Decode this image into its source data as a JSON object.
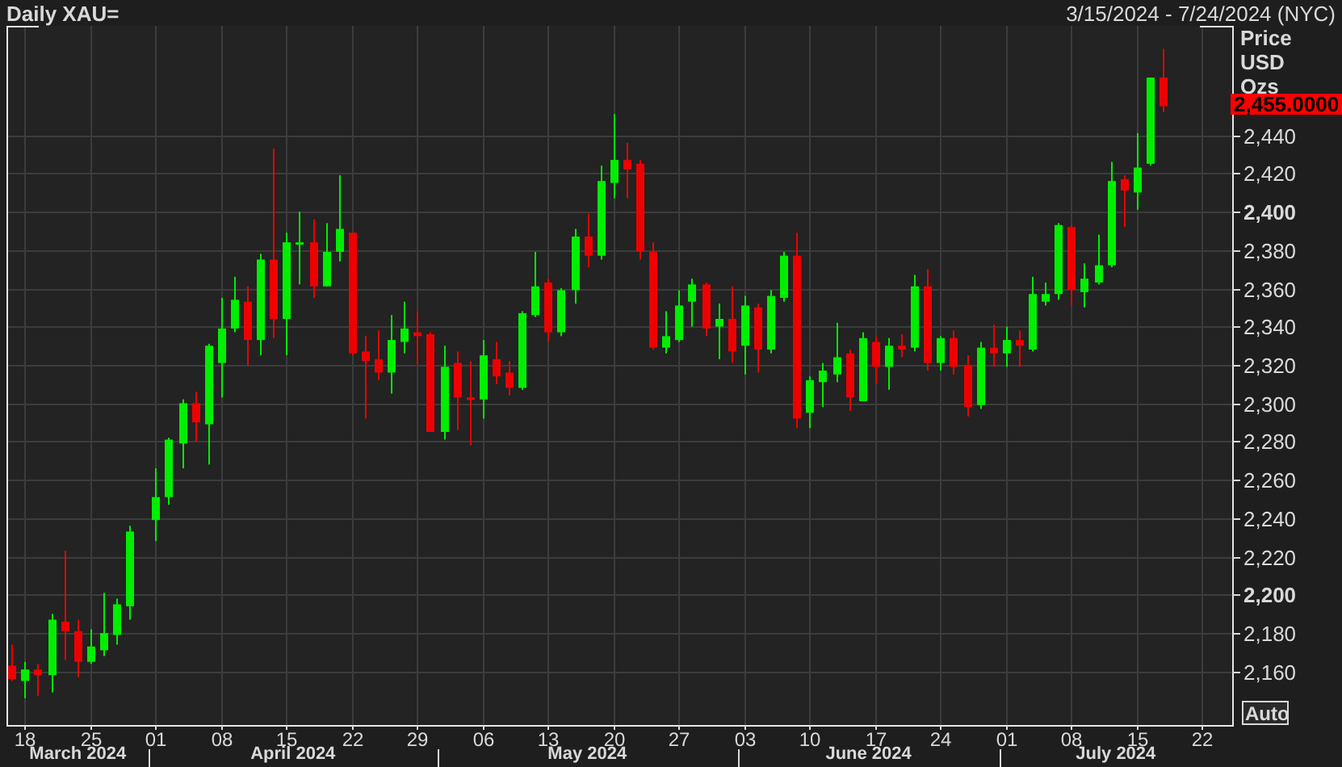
{
  "header": {
    "title": "Daily XAU=",
    "date_range": "3/15/2024 - 7/24/2024 (NYC)"
  },
  "chart": {
    "axis_titles": [
      "Price",
      "USD",
      "Ozs"
    ],
    "last_price": "2,455.0000",
    "auto_button": "Auto",
    "chart_data": {
      "type": "candlestick",
      "grid": true,
      "categories": [
        null,
        "18",
        null,
        null,
        null,
        null,
        "25",
        null,
        null,
        null,
        null,
        "01",
        null,
        null,
        null,
        null,
        "08",
        null,
        null,
        null,
        null,
        "15",
        null,
        null,
        null,
        null,
        "22",
        null,
        null,
        null,
        null,
        "29",
        null,
        null,
        null,
        null,
        "06",
        null,
        null,
        null,
        null,
        "13",
        null,
        null,
        null,
        null,
        "20",
        null,
        null,
        null,
        null,
        "27",
        null,
        null,
        null,
        null,
        "03",
        null,
        null,
        null,
        null,
        "10",
        null,
        null,
        null,
        null,
        "17",
        null,
        null,
        null,
        null,
        "24",
        null,
        null,
        null,
        null,
        "01",
        null,
        null,
        null,
        null,
        "08",
        null,
        null,
        null,
        null,
        "15",
        null,
        null,
        null,
        null,
        "22"
      ],
      "ohlc": [
        [
          2163,
          2174,
          2155,
          2156
        ],
        [
          2155,
          2165,
          2146,
          2161
        ],
        [
          2161,
          2164,
          2147,
          2158
        ],
        [
          2158,
          2190,
          2149,
          2187
        ],
        [
          2186,
          2223,
          2166,
          2181
        ],
        [
          2181,
          2187,
          2157,
          2165
        ],
        [
          2165,
          2182,
          2164,
          2173
        ],
        [
          2171,
          2201,
          2168,
          2180
        ],
        [
          2179,
          2198,
          2174,
          2195
        ],
        [
          2194,
          2236,
          2187,
          2233
        ],
        null,
        [
          2239,
          2266,
          2228,
          2251
        ],
        [
          2251,
          2282,
          2247,
          2281
        ],
        [
          2279,
          2302,
          2266,
          2300
        ],
        [
          2300,
          2306,
          2280,
          2290
        ],
        [
          2289,
          2331,
          2268,
          2330
        ],
        [
          2321,
          2355,
          2303,
          2339
        ],
        [
          2339,
          2366,
          2337,
          2354
        ],
        [
          2353,
          2361,
          2320,
          2333
        ],
        [
          2333,
          2378,
          2325,
          2375
        ],
        [
          2375,
          2433,
          2334,
          2344
        ],
        [
          2344,
          2389,
          2325,
          2384
        ],
        [
          2383,
          2400,
          2362,
          2384
        ],
        [
          2384,
          2396,
          2355,
          2361
        ],
        [
          2361,
          2394,
          2361,
          2379
        ],
        [
          2379,
          2419,
          2374,
          2391
        ],
        [
          2389,
          2389,
          2325,
          2326
        ],
        [
          2327,
          2335,
          2292,
          2322
        ],
        [
          2323,
          2338,
          2312,
          2316
        ],
        [
          2316,
          2346,
          2305,
          2333
        ],
        [
          2332,
          2353,
          2326,
          2339
        ],
        [
          2337,
          2348,
          2320,
          2335
        ],
        [
          2336,
          2337,
          2285,
          2285
        ],
        [
          2285,
          2330,
          2281,
          2319
        ],
        [
          2321,
          2327,
          2286,
          2303
        ],
        [
          2303,
          2322,
          2278,
          2302
        ],
        [
          2302,
          2333,
          2292,
          2325
        ],
        [
          2323,
          2332,
          2310,
          2314
        ],
        [
          2316,
          2322,
          2304,
          2308
        ],
        [
          2308,
          2348,
          2307,
          2347
        ],
        [
          2346,
          2379,
          2345,
          2361
        ],
        [
          2363,
          2365,
          2332,
          2337
        ],
        [
          2337,
          2360,
          2335,
          2359
        ],
        [
          2359,
          2391,
          2352,
          2387
        ],
        [
          2387,
          2399,
          2371,
          2377
        ],
        [
          2377,
          2424,
          2375,
          2416
        ],
        [
          2415,
          2451,
          2407,
          2427
        ],
        [
          2427,
          2436,
          2407,
          2422
        ],
        [
          2425,
          2427,
          2375,
          2379
        ],
        [
          2379,
          2384,
          2328,
          2329
        ],
        [
          2329,
          2348,
          2326,
          2335
        ],
        [
          2333,
          2359,
          2332,
          2351
        ],
        [
          2353,
          2365,
          2340,
          2362
        ],
        [
          2362,
          2363,
          2335,
          2339
        ],
        [
          2340,
          2352,
          2323,
          2344
        ],
        [
          2344,
          2361,
          2321,
          2327
        ],
        [
          2330,
          2356,
          2315,
          2351
        ],
        [
          2350,
          2352,
          2316,
          2328
        ],
        [
          2328,
          2359,
          2326,
          2356
        ],
        [
          2355,
          2379,
          2353,
          2377
        ],
        [
          2377,
          2389,
          2287,
          2292
        ],
        [
          2295,
          2314,
          2287,
          2312
        ],
        [
          2311,
          2321,
          2298,
          2317
        ],
        [
          2315,
          2342,
          2311,
          2324
        ],
        [
          2326,
          2328,
          2296,
          2303
        ],
        [
          2301,
          2337,
          2301,
          2334
        ],
        [
          2332,
          2335,
          2310,
          2319
        ],
        [
          2319,
          2334,
          2307,
          2330
        ],
        [
          2330,
          2336,
          2324,
          2328
        ],
        [
          2329,
          2367,
          2327,
          2361
        ],
        [
          2361,
          2370,
          2317,
          2321
        ],
        [
          2321,
          2335,
          2317,
          2334
        ],
        [
          2334,
          2338,
          2315,
          2319
        ],
        [
          2320,
          2325,
          2293,
          2298
        ],
        [
          2299,
          2332,
          2297,
          2329
        ],
        [
          2329,
          2341,
          2319,
          2326
        ],
        [
          2326,
          2340,
          2319,
          2333
        ],
        [
          2333,
          2338,
          2319,
          2330
        ],
        [
          2328,
          2366,
          2327,
          2357
        ],
        [
          2353,
          2363,
          2351,
          2357
        ],
        [
          2357,
          2394,
          2354,
          2393
        ],
        [
          2392,
          2393,
          2351,
          2359
        ],
        [
          2358,
          2373,
          2350,
          2365
        ],
        [
          2363,
          2388,
          2362,
          2372
        ],
        [
          2372,
          2426,
          2371,
          2416
        ],
        [
          2417,
          2419,
          2392,
          2411
        ],
        [
          2410,
          2441,
          2401,
          2423
        ],
        [
          2425,
          2470,
          2424,
          2470
        ],
        [
          2470,
          2485,
          2452,
          2455
        ],
        null,
        null,
        null
      ],
      "ylim": [
        2132,
        2497
      ],
      "yticks": [
        {
          "value": 2160,
          "label": "2,160"
        },
        {
          "value": 2180,
          "label": "2,180"
        },
        {
          "value": 2200,
          "label": "2,200"
        },
        {
          "value": 2220,
          "label": "2,220"
        },
        {
          "value": 2240,
          "label": "2,240"
        },
        {
          "value": 2260,
          "label": "2,260"
        },
        {
          "value": 2280,
          "label": "2,280"
        },
        {
          "value": 2300,
          "label": "2,300"
        },
        {
          "value": 2320,
          "label": "2,320"
        },
        {
          "value": 2340,
          "label": "2,340"
        },
        {
          "value": 2360,
          "label": "2,360"
        },
        {
          "value": 2380,
          "label": "2,380"
        },
        {
          "value": 2400,
          "label": "2,400"
        },
        {
          "value": 2420,
          "label": "2,420"
        },
        {
          "value": 2440,
          "label": "2,440"
        }
      ],
      "annotations": [
        "March 2024",
        "April 2024",
        "May 2024",
        "June 2024",
        "July 2024"
      ]
    }
  }
}
